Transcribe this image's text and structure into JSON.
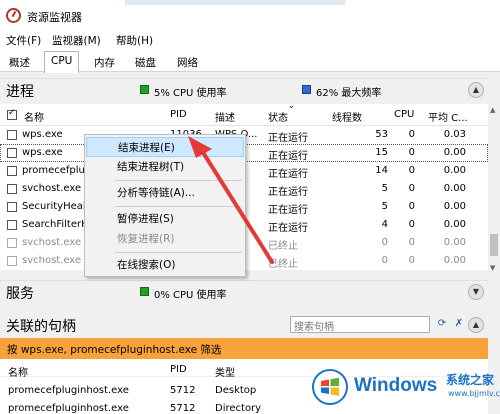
{
  "window": {
    "title": "资源监视器"
  },
  "menu": [
    "文件(F)",
    "监视器(M)",
    "帮助(H)"
  ],
  "tabs": [
    "概述",
    "CPU",
    "内存",
    "磁盘",
    "网络"
  ],
  "processes_section": {
    "title": "进程",
    "cpu_stat": "5% CPU 使用率",
    "freq_stat": "62% 最大频率"
  },
  "columns": {
    "name": "名称",
    "pid": "PID",
    "desc": "描述",
    "status": "状态",
    "threads": "线程数",
    "cpu": "CPU",
    "avg_cpu": "平均 C..."
  },
  "processes": [
    {
      "name": "wps.exe",
      "pid": "11036",
      "desc": "WPS O...",
      "status": "正在运行",
      "threads": "53",
      "cpu": "0",
      "avg": "0.03"
    },
    {
      "name": "wps.exe",
      "pid": "",
      "desc": "",
      "status": "正在运行",
      "threads": "15",
      "cpu": "0",
      "avg": "0.00"
    },
    {
      "name": "promecefplug",
      "pid": "",
      "desc": "",
      "status": "正在运行",
      "threads": "14",
      "cpu": "0",
      "avg": "0.00"
    },
    {
      "name": "svchost.exe (",
      "pid": "",
      "desc": "",
      "status": "正在运行",
      "threads": "5",
      "cpu": "0",
      "avg": "0.00"
    },
    {
      "name": "SecurityHealt",
      "pid": "",
      "desc": "",
      "status": "正在运行",
      "threads": "5",
      "cpu": "0",
      "avg": "0.00"
    },
    {
      "name": "SearchFilterH",
      "pid": "",
      "desc": "",
      "status": "正在运行",
      "threads": "4",
      "cpu": "0",
      "avg": "0.00"
    },
    {
      "name": "svchost.exe (",
      "pid": "",
      "desc": "",
      "status": "已终止",
      "threads": "0",
      "cpu": "0",
      "avg": "0.00"
    },
    {
      "name": "svchost.exe (",
      "pid": "",
      "desc": "",
      "status": "已终止",
      "threads": "0",
      "cpu": "0",
      "avg": "0.00"
    }
  ],
  "services_section": {
    "title": "服务",
    "cpu_stat": "0% CPU 使用率"
  },
  "handles_section": {
    "title": "关联的句柄",
    "search_placeholder": "搜索句柄"
  },
  "filter_text": "按 wps.exe, promecefpluginhost.exe 筛选",
  "handles_columns": {
    "name": "名称",
    "pid": "PID",
    "type": "类型"
  },
  "handles": [
    {
      "name": "promecefpluginhost.exe",
      "pid": "5712",
      "type": "Desktop"
    },
    {
      "name": "promecefpluginhost.exe",
      "pid": "5712",
      "type": "Directory"
    }
  ],
  "context_menu": [
    {
      "label": "结束进程(E)",
      "state": "hover"
    },
    {
      "label": "结束进程树(T)",
      "state": "normal"
    },
    {
      "label": "分析等待链(A)...",
      "state": "normal"
    },
    {
      "label": "暂停进程(S)",
      "state": "normal"
    },
    {
      "label": "恢复进程(R)",
      "state": "disabled"
    },
    {
      "label": "在线搜索(O)",
      "state": "normal"
    }
  ],
  "watermark": {
    "brand": "Windows",
    "cn": "系统之家",
    "url": "www.bjjmlv.com"
  },
  "colors": {
    "filter_bar": "#f8a23a",
    "cpu_green": "#21a121",
    "freq_blue": "#2f6bd0",
    "arrow_red": "#e53935",
    "watermark": "#1b74c5"
  }
}
